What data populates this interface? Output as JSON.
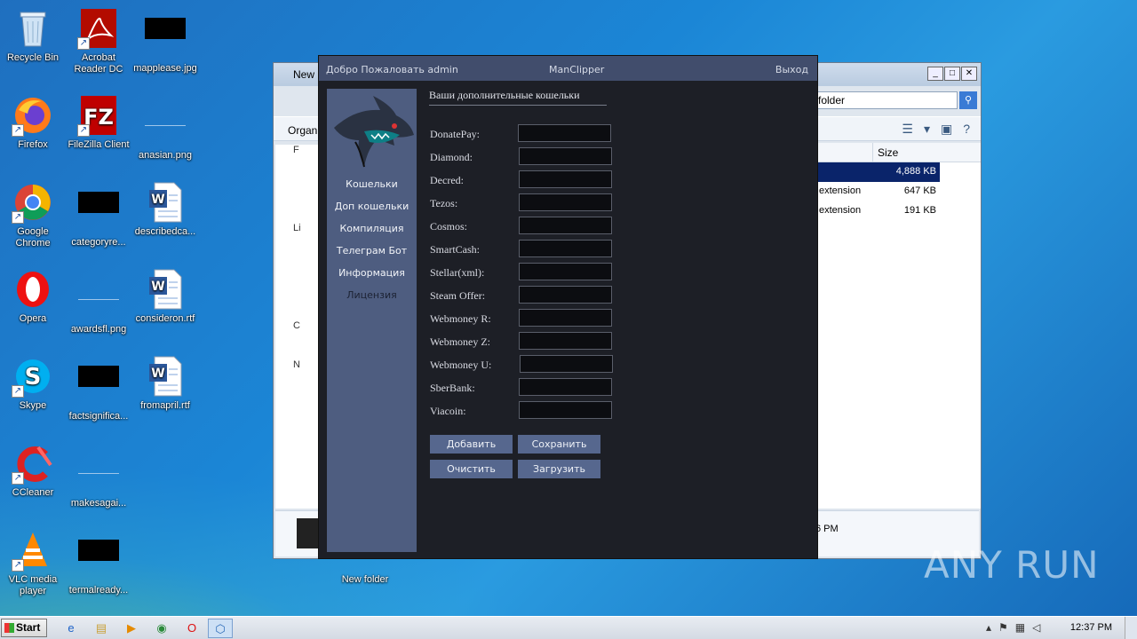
{
  "desktop": {
    "icons": [
      {
        "label": "Recycle Bin"
      },
      {
        "label": "Acrobat Reader DC"
      },
      {
        "label": "mapplease.jpg"
      },
      {
        "label": "Firefox"
      },
      {
        "label": "FileZilla Client"
      },
      {
        "label": "anasian.png"
      },
      {
        "label": "Google Chrome"
      },
      {
        "label": "categoryre..."
      },
      {
        "label": "describedca..."
      },
      {
        "label": "Opera"
      },
      {
        "label": "awardsfl.png"
      },
      {
        "label": "consideron.rtf"
      },
      {
        "label": "Skype"
      },
      {
        "label": "factsignifica..."
      },
      {
        "label": "fromapril.rtf"
      },
      {
        "label": "CCleaner"
      },
      {
        "label": "makesagai..."
      },
      {
        "label": "VLC media player"
      },
      {
        "label": "termalready..."
      },
      {
        "label": "New folder"
      }
    ]
  },
  "explorer": {
    "title": "New",
    "search_text": "folder",
    "organize_label": "Organiz",
    "nav_items": [
      "F",
      "",
      "",
      "",
      "Li",
      "",
      "",
      "",
      "",
      "C",
      "",
      "N"
    ],
    "column_size": "Size",
    "files": [
      {
        "type": "",
        "size": "4,888 KB",
        "selected": true
      },
      {
        "type": "extension",
        "size": "647 KB"
      },
      {
        "type": "extension",
        "size": "191 KB"
      }
    ],
    "details_date": "6 PM"
  },
  "app": {
    "welcome": "Добро Пожаловать  admin",
    "title": "ManClipper",
    "exit_label": "Выход",
    "menu": [
      "Кошельки",
      "Доп кошельки",
      "Компиляция",
      "Телеграм Бот",
      "Информация",
      "Лицензия"
    ],
    "section_title": "Ваши дополнительные кошельки",
    "fields": [
      {
        "label": "DonatePay:",
        "value": ""
      },
      {
        "label": "Diamond:",
        "value": ""
      },
      {
        "label": "Decred:",
        "value": ""
      },
      {
        "label": "Tezos:",
        "value": ""
      },
      {
        "label": "Cosmos:",
        "value": ""
      },
      {
        "label": "SmartCash:",
        "value": ""
      },
      {
        "label": "Stellar(xml):",
        "value": ""
      },
      {
        "label": "Steam Offer:",
        "value": ""
      },
      {
        "label": "Webmoney R:",
        "value": ""
      },
      {
        "label": "Webmoney Z:",
        "value": ""
      },
      {
        "label": "Webmoney U:",
        "value": ""
      },
      {
        "label": "SberBank:",
        "value": ""
      },
      {
        "label": "Viacoin:",
        "value": ""
      }
    ],
    "buttons": {
      "add": "Добавить",
      "save": "Сохранить",
      "clear": "Очистить",
      "load": "Загрузить"
    }
  },
  "watermark": "ANY RUN",
  "taskbar": {
    "start_label": "Start",
    "clock": "12:37 PM"
  }
}
